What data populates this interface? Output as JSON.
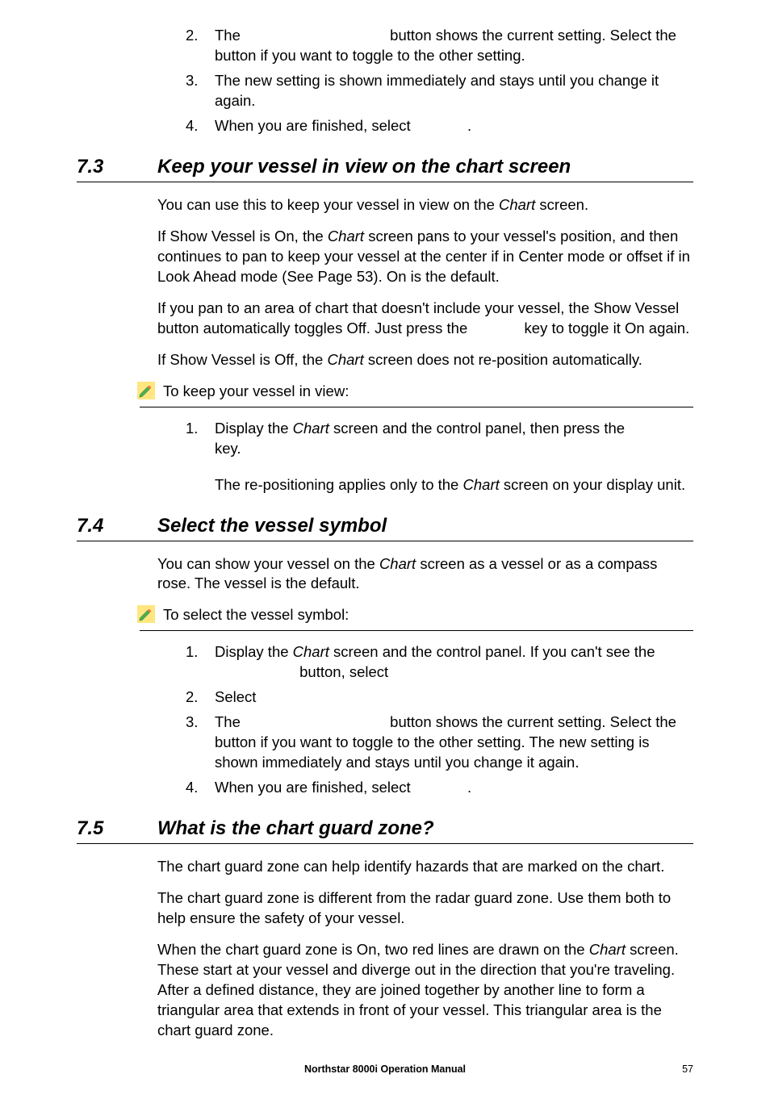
{
  "top_list": {
    "item2_num": "2.",
    "item2_text_a": "The ",
    "item2_text_b": " button shows the current setting. Select the button if you want to toggle to the other setting.",
    "item3_num": "3.",
    "item3_text": "The new setting is shown immediately and stays until you change it again.",
    "item4_num": "4.",
    "item4_text": "When you are finished, select ",
    "item4_trail": "."
  },
  "sec73": {
    "num": "7.3",
    "title": "Keep your vessel in view on the chart screen",
    "p1_a": "You can use this to keep your vessel in view on the ",
    "p1_i": "Chart",
    "p1_b": " screen.",
    "p2_a": "If Show Vessel is On, the ",
    "p2_i": "Chart",
    "p2_b": " screen pans to your vessel's position, and then continues to pan to keep your vessel at the center if in Center mode or offset if in Look Ahead mode (See Page 53). On is the default.",
    "p3_a": "If you pan to an area of chart that doesn't include your vessel, the Show Vessel button automatically toggles Off. Just press the ",
    "p3_b": " key to toggle it On again.",
    "p4_a": "If Show Vessel is Off, the ",
    "p4_i": "Chart",
    "p4_b": " screen does not re-position automatically.",
    "pencil": "To keep your vessel in view:",
    "l1_num": "1.",
    "l1_a": "Display the ",
    "l1_i": "Chart",
    "l1_b": " screen and the control panel, then press the ",
    "l1_c": " key.",
    "sub_a": "The re-positioning applies only to the ",
    "sub_i": "Chart",
    "sub_b": " screen on your display unit."
  },
  "sec74": {
    "num": "7.4",
    "title": "Select the vessel symbol",
    "p1_a": "You can show your vessel on the ",
    "p1_i": "Chart",
    "p1_b": " screen as a vessel or as a compass rose. The vessel is the default.",
    "pencil": "To select the vessel symbol:",
    "l1_num": "1.",
    "l1_a": "Display the ",
    "l1_i": "Chart",
    "l1_b": " screen and the control panel. If you can't see the ",
    "l1_c": " button, select",
    "l2_num": "2.",
    "l2_text": "Select",
    "l3_num": "3.",
    "l3_a": "The ",
    "l3_b": " button shows the current setting. Select the button  if you want to toggle to the other setting. The new setting is shown immediately and stays until you change it again.",
    "l4_num": "4.",
    "l4_text": "When you are finished, select ",
    "l4_trail": "."
  },
  "sec75": {
    "num": "7.5",
    "title": "What is the chart guard zone?",
    "p1": "The chart guard zone can help identify hazards that are marked on the chart.",
    "p2": "The chart guard zone is different from the radar guard zone. Use them both to help ensure the safety of your vessel.",
    "p3_a": "When the chart guard zone is On, two red lines are drawn on the ",
    "p3_i": "Chart",
    "p3_b": " screen. These start at your vessel and diverge out in the direction that you're traveling. After a defined distance, they are joined together by another line to form a triangular area that extends in front of your vessel. This triangular area is the chart guard zone."
  },
  "footer": {
    "title": "Northstar 8000i Operation Manual",
    "page": "57"
  }
}
